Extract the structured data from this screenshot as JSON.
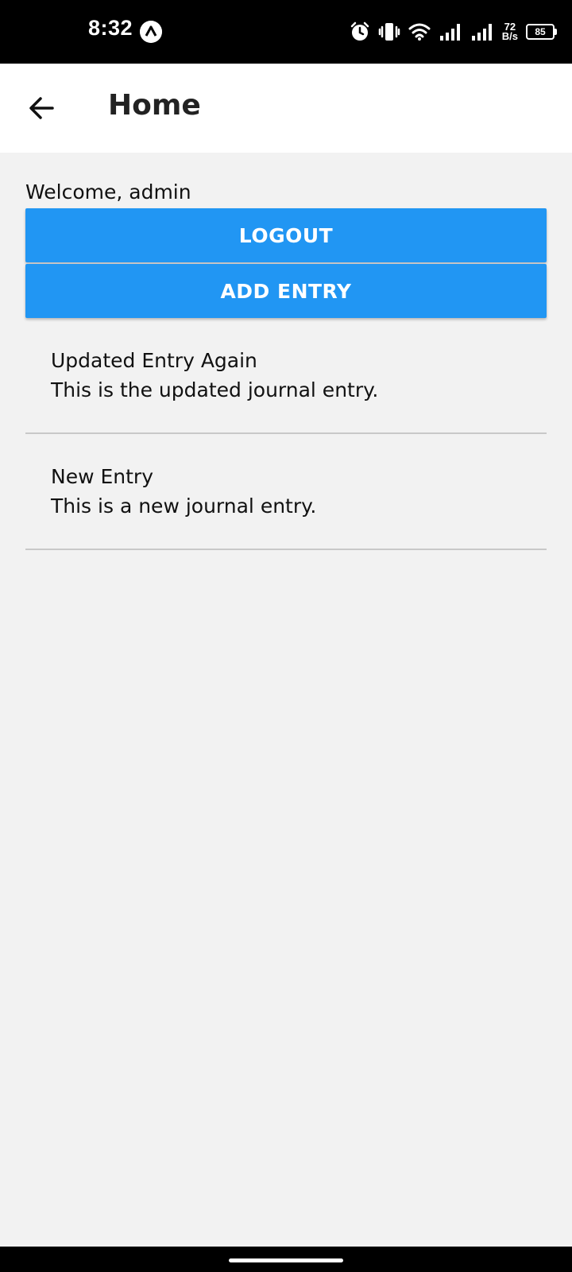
{
  "status_bar": {
    "time": "8:32",
    "net_speed_value": "72",
    "net_speed_unit": "B/s",
    "battery": "85",
    "icons": [
      "alarm-icon",
      "vibrate-icon",
      "wifi-icon",
      "signal-icon",
      "signal-icon"
    ]
  },
  "app_bar": {
    "title": "Home",
    "back_icon": "arrow-left-icon"
  },
  "main": {
    "welcome": "Welcome, admin",
    "logout_label": "LOGOUT",
    "add_entry_label": "ADD ENTRY",
    "entries": [
      {
        "title": "Updated Entry Again",
        "body": "This is the updated journal entry."
      },
      {
        "title": "New Entry",
        "body": "This is a new journal entry."
      }
    ]
  },
  "colors": {
    "accent": "#2196f3",
    "background": "#f2f2f2",
    "app_bar": "#ffffff",
    "divider": "#c8c8c8"
  }
}
